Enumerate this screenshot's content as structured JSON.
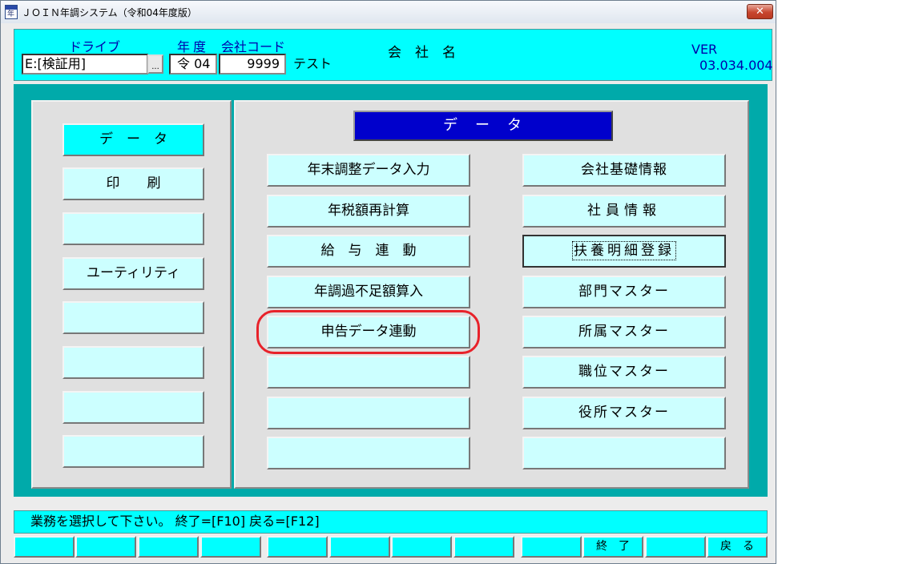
{
  "window": {
    "title": "ＪＯＩＮ年調システム（令和04年度版）",
    "close_glyph": "✕"
  },
  "header": {
    "drive_label": "ドライブ",
    "drive_value": "E:[検証用]",
    "browse_label": "...",
    "year_label": "年度",
    "company_code_label": "会社コード",
    "year_value": "令 04",
    "company_code_value": "9999",
    "company_name_value": "テスト",
    "company_name_label": "会　社　名",
    "ver_label": "VER",
    "ver_value": "03.034.004"
  },
  "left_menu": [
    "デ　ー　タ",
    "印　　刷",
    "",
    "ユーティリティ",
    "",
    "",
    "",
    ""
  ],
  "section_title": "デ　ー　タ",
  "data_menu_left": [
    "年末調整データ入力",
    "年税額再計算",
    "給　与　連　動",
    "年調過不足額算入",
    "申告データ連動",
    "",
    "",
    ""
  ],
  "data_menu_right": [
    "会社基礎情報",
    "社員情報",
    "扶養明細登録",
    "部門マスター",
    "所属マスター",
    "職位マスター",
    "役所マスター",
    ""
  ],
  "status_message": "業務を選択して下さい。 終了=[F10]  戻る=[F12]",
  "function_keys": [
    "",
    "",
    "",
    "",
    "",
    "",
    "",
    "",
    "",
    "終　了",
    "",
    "戻　る"
  ],
  "colors": {
    "header_bg": "#00ffff",
    "main_bg": "#00aaaa",
    "button_bg": "#ccffff",
    "selected_bg": "#00ffff",
    "section_title_bg": "#0000cc",
    "label_blue": "#0000aa",
    "highlight_ring": "#e8222a"
  }
}
